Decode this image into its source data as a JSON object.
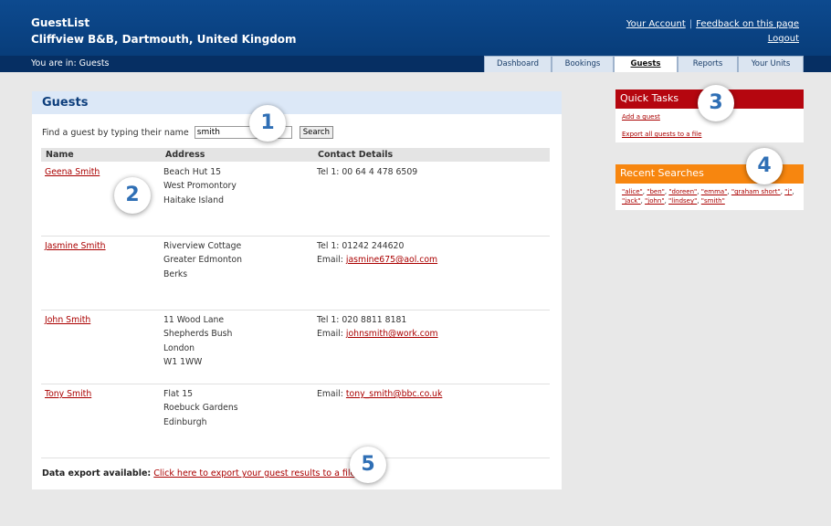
{
  "header": {
    "app_name": "GuestList",
    "property_name": "Cliffview B&B, Dartmouth, United Kingdom",
    "your_account": "Your Account",
    "separator": "|",
    "feedback": "Feedback on this page",
    "logout": "Logout"
  },
  "breadcrumb": "You are in: Guests",
  "tabs": [
    {
      "label": "Dashboard"
    },
    {
      "label": "Bookings"
    },
    {
      "label": "Guests"
    },
    {
      "label": "Reports"
    },
    {
      "label": "Your Units"
    }
  ],
  "guests_panel": {
    "title": "Guests",
    "search_label": "Find a guest by typing their name",
    "search_value": "smith",
    "search_button": "Search",
    "columns": [
      "Name",
      "Address",
      "Contact Details"
    ],
    "rows": [
      {
        "name": "Geena Smith",
        "address": [
          "Beach Hut 15",
          "West Promontory",
          "Haitake Island"
        ],
        "phone": "Tel 1: 00 64 4 478 6509",
        "email_label": "",
        "email": ""
      },
      {
        "name": "Jasmine Smith",
        "address": [
          "Riverview Cottage",
          "Greater Edmonton",
          "Berks"
        ],
        "phone": "Tel 1: 01242 244620",
        "email_label": "Email:",
        "email": "jasmine675@aol.com"
      },
      {
        "name": "John Smith",
        "address": [
          "11 Wood Lane",
          "Shepherds Bush",
          "London",
          "W1 1WW"
        ],
        "phone": "Tel 1: 020 8811 8181",
        "email_label": "Email:",
        "email": "johnsmith@work.com"
      },
      {
        "name": "Tony Smith",
        "address": [
          "Flat 15",
          "Roebuck Gardens",
          "Edinburgh"
        ],
        "phone": "",
        "email_label": "Email:",
        "email": "tony_smith@bbc.co.uk"
      }
    ],
    "export_label": "Data export available:",
    "export_link": "Click here to export your guest results to a file."
  },
  "quick_tasks": {
    "title": "Quick Tasks",
    "color": "#b5060f",
    "links": [
      "Add a guest",
      "Export all guests to a file"
    ]
  },
  "recent_searches": {
    "title": "Recent Searches",
    "color": "#f7860f",
    "items": [
      "\"alice\"",
      "\"ben\"",
      "\"doreen\"",
      "\"emma\"",
      "\"graham short\"",
      "\"j\"",
      "\"jack\"",
      "\"john\"",
      "\"lindsey\"",
      "\"smith\""
    ]
  },
  "badges": [
    "1",
    "2",
    "3",
    "4",
    "5"
  ],
  "colors": {
    "header_blue": "#0d4a8f",
    "link_red": "#aa0000",
    "panel_title_bg": "#dce8f7",
    "badge_blue": "#2f6fb5"
  }
}
